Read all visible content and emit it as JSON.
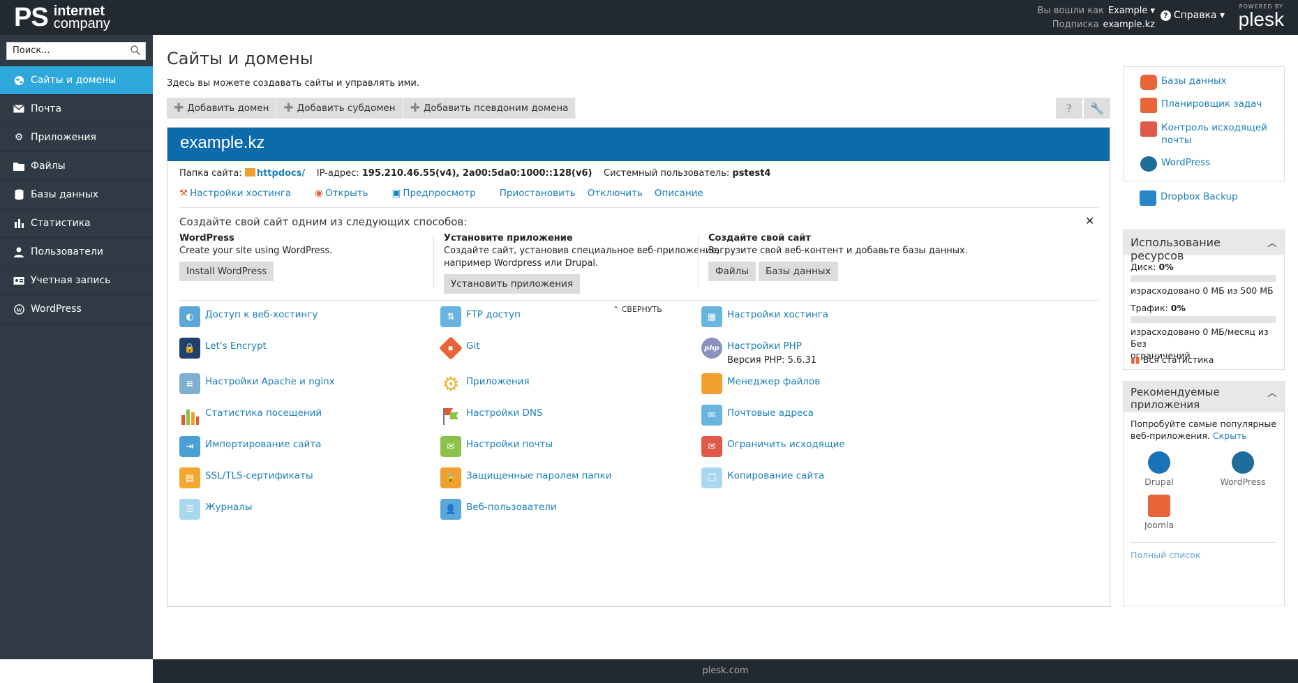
{
  "header": {
    "logo_main": "PS",
    "logo_line1": "internet",
    "logo_line2": "company",
    "logged_in_label": "Вы вошли как",
    "logged_in_user": "Example ▾",
    "subscription_label": "Подписка",
    "subscription_value": "example.kz",
    "help_label": "Справка ▾",
    "powered_by": "POWERED BY",
    "plesk": "plesk"
  },
  "sidebar": {
    "search_placeholder": "Поиск...",
    "items": [
      {
        "label": "Сайты и домены",
        "icon": "globe-icon"
      },
      {
        "label": "Почта",
        "icon": "mail-icon"
      },
      {
        "label": "Приложения",
        "icon": "gear-icon"
      },
      {
        "label": "Файлы",
        "icon": "folder-icon"
      },
      {
        "label": "Базы данных",
        "icon": "database-icon"
      },
      {
        "label": "Статистика",
        "icon": "bar-chart-icon"
      },
      {
        "label": "Пользователи",
        "icon": "user-icon"
      },
      {
        "label": "Учетная запись",
        "icon": "account-icon"
      },
      {
        "label": "WordPress",
        "icon": "wordpress-icon"
      }
    ]
  },
  "main": {
    "title": "Сайты и домены",
    "description": "Здесь вы можете создавать сайты и управлять ими.",
    "toolbar": {
      "add_domain": "Добавить домен",
      "add_subdomain": "Добавить субдомен",
      "add_alias": "Добавить псевдоним домена"
    },
    "domain": {
      "name": "example.kz",
      "folder_label": "Папка сайта:",
      "folder_value": "httpdocs/",
      "ip_label": "IP-адрес:",
      "ip_value": "195.210.46.55(v4), 2a00:5da0:1000::128(v6)",
      "sysuser_label": "Системный пользователь:",
      "sysuser_value": "pstest4",
      "links": [
        "Настройки хостинга",
        "Открыть",
        "Предпросмотр",
        "Приостановить",
        "Отключить",
        "Описание"
      ],
      "create_title": "Создайте свой сайт одним из следующих способов:",
      "col1": {
        "title": "WordPress",
        "text": "Create your site using WordPress.",
        "button": "Install WordPress"
      },
      "col2": {
        "title": "Установите приложение",
        "text1": "Создайте сайт, установив специальное веб-приложение,",
        "text2": "например Wordpress или Drupal.",
        "button": "Установить приложения"
      },
      "col3": {
        "title": "Создайте свой сайт",
        "text": "Загрузите свой веб-контент и добавьте базы данных.",
        "btn1": "Файлы",
        "btn2": "Базы данных"
      },
      "collapse": "⌃ СВЕРНУТЬ",
      "tools": {
        "c1": [
          "Доступ к веб-хостингу",
          "Let's Encrypt",
          "Настройки Apache и nginx",
          "Статистика посещений",
          "Импортирование сайта",
          "SSL/TLS-сертификаты",
          "Журналы"
        ],
        "c2": [
          "FTP доступ",
          "Git",
          "Приложения",
          "Настройки DNS",
          "Настройки почты",
          "Защищенные паролем папки",
          "Веб-пользователи"
        ],
        "c3": [
          "Настройки хостинга",
          "Настройки PHP",
          "Менеджер файлов",
          "Почтовые адреса",
          "Ограничить исходящие",
          "Копирование сайта"
        ],
        "php_version": "Версия PHP: 5.6.31"
      }
    }
  },
  "right": {
    "quick": [
      "Базы данных",
      "Планировщик задач",
      "Контроль исходящей",
      "почты",
      "WordPress",
      "Dropbox Backup"
    ],
    "resources": {
      "title": "Использование ресурсов",
      "disk_label": "Диск:",
      "disk_value": "0%",
      "disk_text": "израсходовано 0 МБ из 500 МБ",
      "traffic_label": "Трафик:",
      "traffic_value": "0%",
      "traffic_text1": "израсходовано 0 МБ/месяц из Без",
      "traffic_text2": "ограничений",
      "all_stats": "Вся статистика"
    },
    "recommended": {
      "title1": "Рекомендуемые",
      "title2": "приложения",
      "text1": "Попробуйте самые популярные",
      "text2": "веб-приложения.",
      "hide": "Скрыть",
      "apps": [
        "Drupal",
        "WordPress",
        "Joomla"
      ],
      "full_list": "Полный список"
    }
  },
  "footer": {
    "text": "plesk.com"
  }
}
